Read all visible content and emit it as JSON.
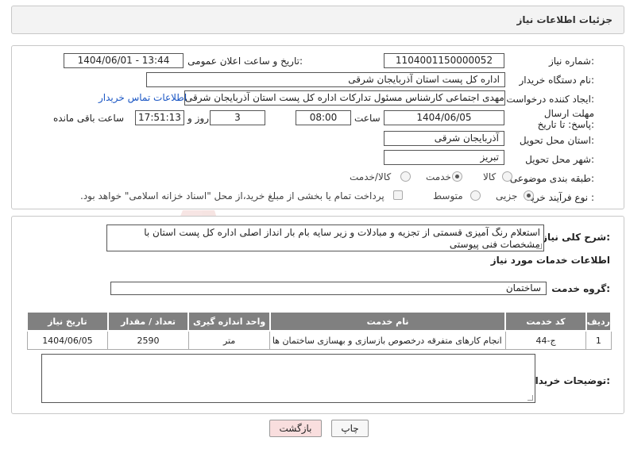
{
  "header": {
    "title": "جزئیات اطلاعات نیاز"
  },
  "form": {
    "need_number": {
      "label": "شماره نیاز:",
      "value": "1104001150000052"
    },
    "announce_datetime": {
      "label": "تاریخ و ساعت اعلان عمومی:",
      "value": "1404/06/01 - 13:44"
    },
    "buyer_org": {
      "label": "نام دستگاه خریدار:",
      "value": "اداره کل پست استان آذربایجان شرقی"
    },
    "requester": {
      "label": "ایجاد کننده درخواست:",
      "value": "مهدی اجتماعی کارشناس مسئول تدارکات اداره کل پست استان آذربایجان شرقی",
      "contact_link": "اطلاعات تماس خریدار"
    },
    "deadline": {
      "label": "مهلت ارسال پاسخ: تا تاریخ:",
      "date": "1404/06/05",
      "time_label": "ساعت",
      "time": "08:00",
      "days": "3",
      "days_label": "روز و",
      "remaining": "17:51:13",
      "remaining_label": "ساعت باقی مانده"
    },
    "delivery_province": {
      "label": "استان محل تحویل:",
      "value": "آذربایجان شرقی"
    },
    "delivery_city": {
      "label": "شهر محل تحویل:",
      "value": "تبریز"
    },
    "category": {
      "label": "طبقه بندی موضوعی:",
      "options": [
        "کالا",
        "خدمت",
        "کالا/خدمت"
      ],
      "selected": "خدمت"
    },
    "process_type": {
      "label": "نوع فرآیند خرید :",
      "options": [
        "جزیی",
        "متوسط"
      ],
      "selected": "جزیی",
      "payment_note": "پرداخت تمام یا بخشی از مبلغ خرید،از محل \"اسناد خزانه اسلامی\" خواهد بود."
    }
  },
  "description": {
    "label": "شرح کلی نیاز:",
    "text": "استعلام رنگ آمیزی قسمتی از تجزیه و مبادلات و زیر سایه بام بار انداز اصلی اداره کل پست استان با مشخصات فنی پیوستی"
  },
  "services": {
    "title": "اطلاعات خدمات مورد نیاز",
    "group_label": "گروه خدمت:",
    "group_value": "ساختمان",
    "columns": [
      "ردیف",
      "کد خدمت",
      "نام خدمت",
      "واحد اندازه گیری",
      "تعداد / مقدار",
      "تاریخ نیاز"
    ],
    "rows": [
      [
        "1",
        "ج-44",
        "انجام کارهای متفرقه درخصوص بازسازی و بهسازی ساختمان ها",
        "متر",
        "2590",
        "1404/06/05"
      ]
    ]
  },
  "buyer_notes": {
    "label": "توضیحات خریدار:",
    "value": ""
  },
  "buttons": {
    "print": "چاپ",
    "back": "بازگشت"
  },
  "watermark": {
    "text": "AriaTender.net"
  },
  "colors": {
    "header_bg": "#f3f3f3",
    "table_header": "#808080",
    "link": "#1a56c4",
    "back_button": "#f9dede"
  }
}
